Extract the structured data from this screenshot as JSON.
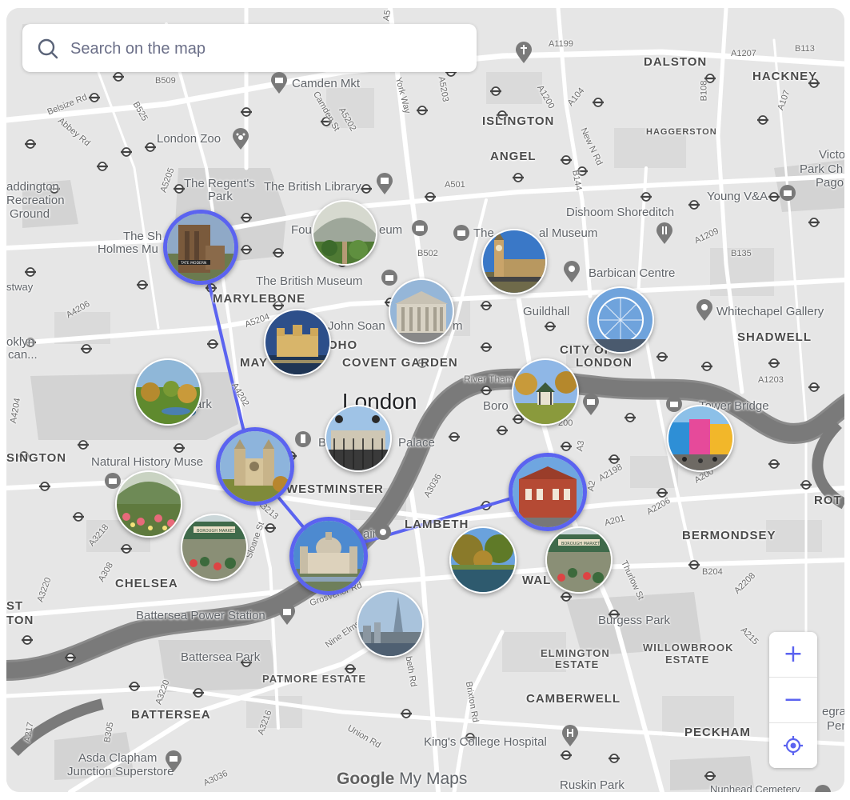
{
  "search": {
    "placeholder": "Search on the map",
    "icon": "search-icon"
  },
  "city_label": "London",
  "districts": {
    "dalston": "DALSTON",
    "hackney": "HACKNEY",
    "islington": "ISLINGTON",
    "angel": "ANGEL",
    "marylebone": "MARYLEBONE",
    "soho": "OHO",
    "mayfair": "MAY",
    "covent_garden": "COVENT GARDEN",
    "city_of_london_1": "CITY OF",
    "city_of_london_2": "LONDON",
    "shadwell": "SHADWELL",
    "westminster": "WESTMINSTER",
    "lambeth": "LAMBETH",
    "bermondsey": "BERMONDSEY",
    "chelsea": "CHELSEA",
    "walworth": "WAL",
    "kensington": "SINGTON",
    "patmore": "PATMORE ESTATE",
    "elmington_1": "ELMINGTON",
    "elmington_2": "ESTATE",
    "willowbrook_1": "WILLOWBROOK",
    "willowbrook_2": "ESTATE",
    "camberwell": "CAMBERWELL",
    "battersea": "BATTERSEA",
    "peckham": "PECKHAM",
    "haggerston": "HAGGERSTON",
    "rot": "ROT",
    "ton": "TON",
    "st": "ST"
  },
  "places": {
    "camden_mkt": "Camden Mkt",
    "london_zoo": "London Zoo",
    "regents_park_1": "The Regent's",
    "regents_park_2": "Park",
    "british_library": "The British Library",
    "paddington_1": "addington",
    "paddington_2": "Recreation",
    "paddington_3": "Ground",
    "sherlock_1": "The Sh",
    "sherlock_2": "Holmes Mu",
    "four": "Fou",
    "eum": "eum",
    "dishoom": "Dishoom Shoreditch",
    "young_va": "Young V&A",
    "victoria_1": "Victo",
    "victoria_2": "Park Ch",
    "victoria_3": "Pago",
    "british_museum": "The British Museum",
    "the": "The",
    "al_museum": "al Museum",
    "barbican": "Barbican Centre",
    "guildhall": "Guildhall",
    "whitechapel": "Whitechapel Gallery",
    "john_soane": "John Soan",
    "m": "m",
    "river_thames": "River Tham",
    "borough": "Boro",
    "tower_bridge": "Tower Bridge",
    "ark": "ark",
    "palace": "Palace",
    "b_pal": "B",
    "natural_history": "Natural History Muse",
    "lambeth_g": "ain",
    "burgess_park": "Burgess Park",
    "battersea_power": "Battersea Power Station",
    "battersea_park": "Battersea Park",
    "kings_college": "King's College Hospital",
    "asda_1": "Asda Clapham",
    "asda_2": "Junction Superstore",
    "ruskin": "Ruskin Park",
    "nunhead": "Nunhead Cemetery",
    "brooklyn_1": "oklyn",
    "brooklyn_2": "can...",
    "stway": "stway",
    "egrap": "egrap",
    "pen": "Pen"
  },
  "roads": {
    "a5": "A5",
    "a1199": "A1199",
    "a1207": "A1207",
    "b113": "B113",
    "b509": "B509",
    "belsize": "Belsize Rd",
    "abbey": "Abbey Rd",
    "b525": "B525",
    "camden_st": "Camden St",
    "a5202": "A5202",
    "york_way": "York Way",
    "a5203": "A5203",
    "a1200": "A1200",
    "a104": "A104",
    "b108": "B108",
    "a107": "A107",
    "new_n_rd": "New N Rd",
    "a5205": "A5205",
    "a501": "A501",
    "b144": "B144",
    "a1209": "A1209",
    "b135": "B135",
    "b502": "B502",
    "a4206": "A4206",
    "a5204": "A5204",
    "a4202": "A4202",
    "a4204": "A4204",
    "a1203": "A1203",
    "a200": "A200",
    "a3": "A3",
    "a2198": "A2198",
    "a2": "A2",
    "a2206": "A2206",
    "a201": "A201",
    "a3036": "A3036",
    "a3213": "A3213",
    "sloane_st": "Sloane St",
    "a3218": "A3218",
    "a308": "A308",
    "a3220": "A3220",
    "grosvenor": "Grosvenor Rd",
    "nine_elms": "Nine Elms",
    "kenn": "beth Rd",
    "brixton": "Brixton Rd",
    "thurlow": "Thurlow St",
    "b204": "B204",
    "a2208": "A2208",
    "a215": "A215",
    "a216": "A3216",
    "b305": "B305",
    "a217": "A217",
    "a3036b": "A3036",
    "union": "Union Rd",
    "a200b": "200"
  },
  "photo_markers": [
    {
      "name": "tate-modern",
      "scene": "tate",
      "route": true
    },
    {
      "name": "kew-gardens-glasshouse",
      "scene": "garden",
      "route": false
    },
    {
      "name": "big-ben",
      "scene": "bigben",
      "route": false
    },
    {
      "name": "british-museum",
      "scene": "museum",
      "route": false
    },
    {
      "name": "london-eye",
      "scene": "eye",
      "route": false
    },
    {
      "name": "tower-of-london",
      "scene": "tower",
      "route": false
    },
    {
      "name": "hyde-park",
      "scene": "park",
      "route": false
    },
    {
      "name": "bandstand-park",
      "scene": "bandstand",
      "route": false
    },
    {
      "name": "camden-market",
      "scene": "camden",
      "route": false
    },
    {
      "name": "buckingham-palace",
      "scene": "palace",
      "route": false
    },
    {
      "name": "westminster-abbey",
      "scene": "abbey",
      "route": true
    },
    {
      "name": "columbia-road-market",
      "scene": "flower",
      "route": false
    },
    {
      "name": "va-museum",
      "scene": "redbrick",
      "route": true
    },
    {
      "name": "borough-market",
      "scene": "market",
      "route": false
    },
    {
      "name": "st-pauls",
      "scene": "stpauls",
      "route": true
    },
    {
      "name": "st-james-park",
      "scene": "lake",
      "route": false
    },
    {
      "name": "borough-market-2",
      "scene": "market",
      "route": false
    },
    {
      "name": "the-shard",
      "scene": "shard",
      "route": false
    }
  ],
  "zoom": {
    "in_symbol": "+",
    "out_symbol": "−"
  },
  "brand": {
    "google": "Google",
    "my_maps": " My Maps"
  },
  "colors": {
    "route": "#5b63f0",
    "water": "#7e7e7e",
    "park": "#d4d4d4",
    "road": "#ffffff",
    "land": "#e6e6e6"
  }
}
